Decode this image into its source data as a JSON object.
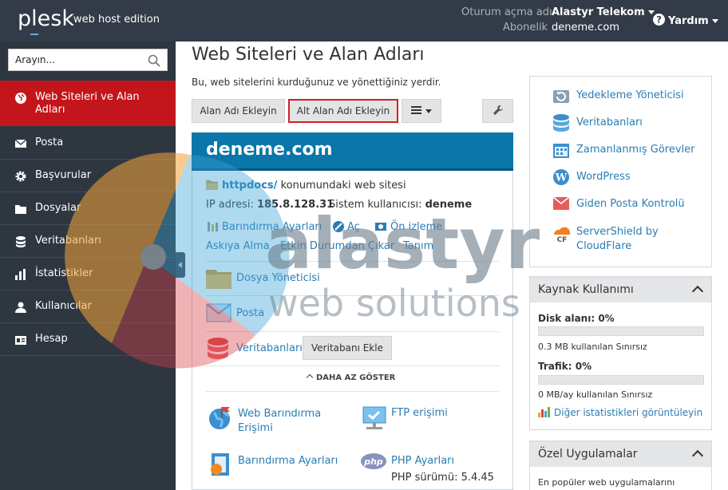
{
  "header": {
    "logo": "plesk",
    "edition": "web host edition",
    "login_label": "Oturum açma adı",
    "login_value": "Alastyr Telekom",
    "subscription_label": "Abonelik",
    "subscription_value": "deneme.com",
    "help": "Yardım"
  },
  "sidebar": {
    "search_placeholder": "Arayın...",
    "items": [
      {
        "label": "Web Siteleri ve Alan Adları",
        "icon": "globe-icon",
        "active": true
      },
      {
        "label": "Posta",
        "icon": "envelope-icon"
      },
      {
        "label": "Başvurular",
        "icon": "gear-icon"
      },
      {
        "label": "Dosyalar",
        "icon": "folder-icon"
      },
      {
        "label": "Veritabanları",
        "icon": "database-icon"
      },
      {
        "label": "İstatistikler",
        "icon": "bar-chart-icon"
      },
      {
        "label": "Kullanıcılar",
        "icon": "user-icon"
      },
      {
        "label": "Hesap",
        "icon": "id-card-icon"
      }
    ]
  },
  "main": {
    "title": "Web Siteleri ve Alan Adları",
    "description": "Bu, web sitelerini kurduğunuz ve yönettiğiniz yerdir.",
    "buttons": {
      "add_domain": "Alan Adı Ekleyin",
      "add_subdomain": "Alt Alan Adı Ekleyin"
    },
    "domain": {
      "name": "deneme.com",
      "httpdocs_link": "httpdocs/",
      "httpdocs_text": "konumundaki web sitesi",
      "ip_label": "IP adresi:",
      "ip_value": "185.8.128.31",
      "sysuser_label": "Sistem kullanıcısı:",
      "sysuser_value": "deneme",
      "actions": [
        "Barındırma Ayarları",
        "Aç",
        "Ön izleme"
      ],
      "actions2": [
        "Askıya Alma",
        "Etkin Durumdan Çıkar",
        "Tanım"
      ],
      "tools": {
        "file_manager": "Dosya Yöneticisi",
        "mail": "Posta",
        "databases": "Veritabanları",
        "add_database": "Veritabanı Ekle"
      },
      "show_less": "DAHA AZ GÖSTER",
      "extras": {
        "web_hosting_access": "Web Barındırma Erişimi",
        "ftp_access": "FTP erişimi",
        "hosting_settings": "Barındırma Ayarları",
        "php_settings": "PHP Ayarları",
        "php_version": "PHP sürümü: 5.4.45"
      }
    }
  },
  "right": {
    "links": [
      "Yedekleme Yöneticisi",
      "Veritabanları",
      "Zamanlanmış Görevler",
      "WordPress",
      "Giden Posta Kontrolü",
      "ServerShield by CloudFlare"
    ],
    "resource": {
      "title": "Kaynak Kullanımı",
      "disk_label": "Disk alanı: 0%",
      "disk_usage_percent": 0,
      "disk_text": "0.3 MB kullanılan Sınırsız",
      "traffic_label": "Trafik: 0%",
      "traffic_usage_percent": 0,
      "traffic_text": "0 MB/ay kullanılan Sınırsız",
      "stats_link": "Diğer istatistikleri görüntüleyin"
    },
    "custom_apps": {
      "title": "Özel Uygulamalar",
      "text": "En popüler web uygulamalarını"
    }
  },
  "watermark": {
    "line1": "alastyr",
    "line2": "web solutions"
  },
  "colors": {
    "sidebar": "#2e3640",
    "header": "#323b47",
    "active": "#c3161c",
    "accent": "#0b76a9",
    "link": "#2a7db4"
  }
}
